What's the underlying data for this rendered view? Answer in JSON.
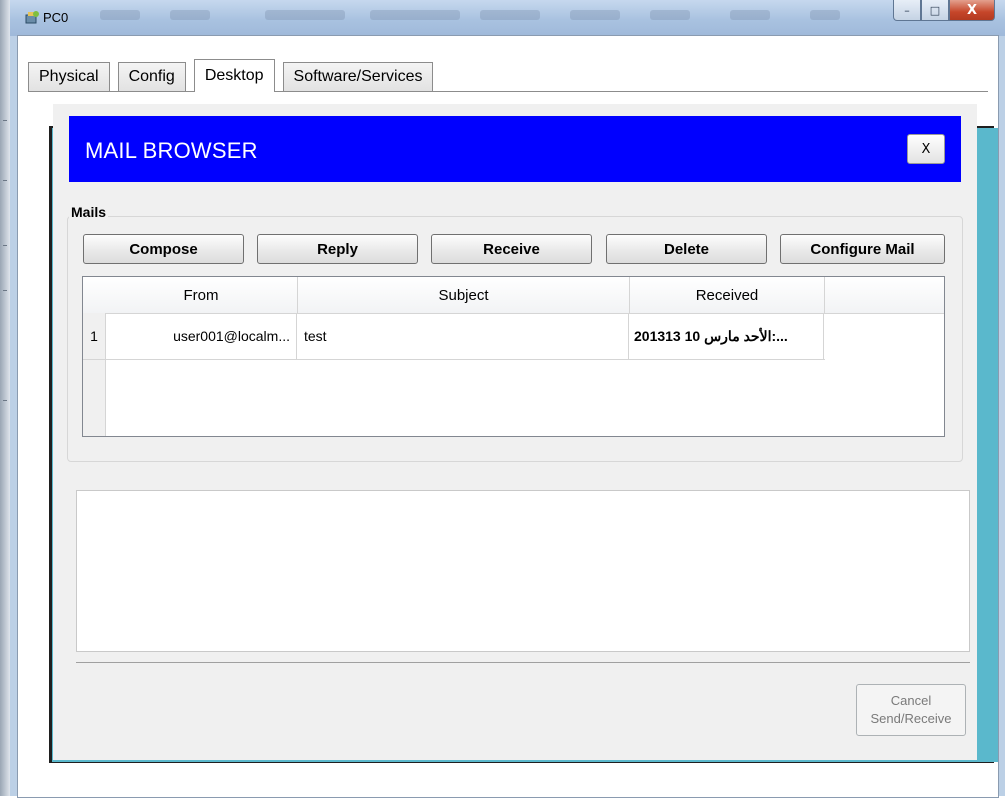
{
  "window": {
    "title": "PC0",
    "controls": {
      "minimize": "–",
      "maximize": "□",
      "close": "X"
    }
  },
  "tabs": [
    {
      "label": "Physical",
      "active": false
    },
    {
      "label": "Config",
      "active": false
    },
    {
      "label": "Desktop",
      "active": true
    },
    {
      "label": "Software/Services",
      "active": false
    }
  ],
  "mail_browser": {
    "title": "MAIL BROWSER",
    "close_label": "X",
    "group_label": "Mails",
    "buttons": {
      "compose": "Compose",
      "reply": "Reply",
      "receive": "Receive",
      "delete": "Delete",
      "configure": "Configure Mail"
    },
    "table": {
      "columns": [
        "From",
        "Subject",
        "Received"
      ],
      "rows": [
        {
          "num": "1",
          "from": "user001@localm...",
          "subject": "test",
          "received": "...:الأحد مارس 10 201313"
        }
      ]
    },
    "cancel_label_line1": "Cancel",
    "cancel_label_line2": "Send/Receive"
  },
  "colors": {
    "header_blue": "#0000ff",
    "desktop_teal": "#5ab8cc",
    "close_red": "#c6462a"
  }
}
